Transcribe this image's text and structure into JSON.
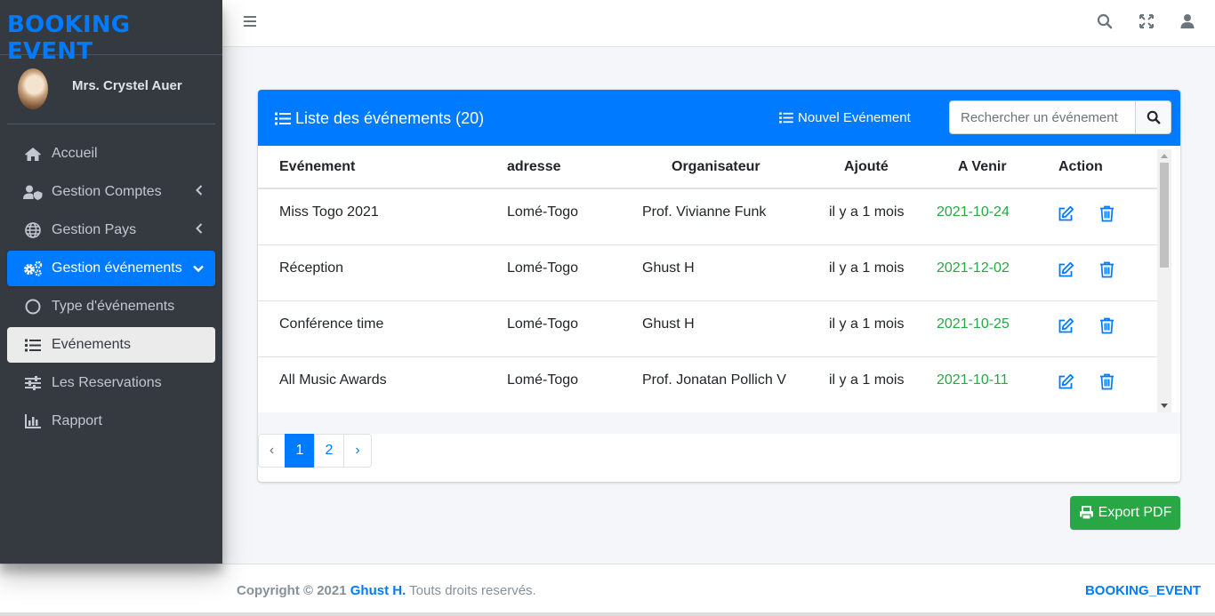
{
  "brand": "BOOKING EVENT",
  "user": {
    "name": "Mrs. Crystel Auer"
  },
  "sidebar": {
    "items": [
      {
        "label": "Accueil",
        "icon": "home-icon"
      },
      {
        "label": "Gestion Comptes",
        "icon": "user-shield-icon"
      },
      {
        "label": "Gestion Pays",
        "icon": "globe-icon"
      },
      {
        "label": "Gestion événements",
        "icon": "gears-icon"
      },
      {
        "label": "Type d'événements",
        "icon": "circle-icon"
      },
      {
        "label": "Evénements",
        "icon": "list-icon"
      },
      {
        "label": "Les Reservations",
        "icon": "sliders-icon"
      },
      {
        "label": "Rapport",
        "icon": "bar-chart-icon"
      }
    ]
  },
  "card": {
    "title": "Liste des événements (20)",
    "new_button": "Nouvel Evénement",
    "search_placeholder": "Rechercher un événement"
  },
  "table": {
    "headers": [
      "Evénement",
      "adresse",
      "Organisateur",
      "Ajouté",
      "A Venir",
      "Action"
    ],
    "rows": [
      {
        "name": "Miss Togo 2021",
        "address": "Lomé-Togo",
        "organizer": "Prof. Vivianne Funk",
        "added": "il y a 1 mois",
        "date": "2021-10-24"
      },
      {
        "name": "Réception",
        "address": "Lomé-Togo",
        "organizer": "Ghust H",
        "added": "il y a 1 mois",
        "date": "2021-12-02"
      },
      {
        "name": "Conférence time",
        "address": "Lomé-Togo",
        "organizer": "Ghust H",
        "added": "il y a 1 mois",
        "date": "2021-10-25"
      },
      {
        "name": "All Music Awards",
        "address": "Lomé-Togo",
        "organizer": "Prof. Jonatan Pollich V",
        "added": "il y a 1 mois",
        "date": "2021-10-11"
      }
    ]
  },
  "pagination": {
    "prev": "‹",
    "pages": [
      "1",
      "2"
    ],
    "next": "›",
    "current": "1"
  },
  "export_button": "Export PDF",
  "footer": {
    "copyright": "Copyright © 2021",
    "author": "Ghust H.",
    "rights": "Touts droits reservés.",
    "brand": "BOOKING_EVENT"
  },
  "colors": {
    "primary": "#007bff",
    "success": "#28a745",
    "sidebar": "#343a40"
  }
}
